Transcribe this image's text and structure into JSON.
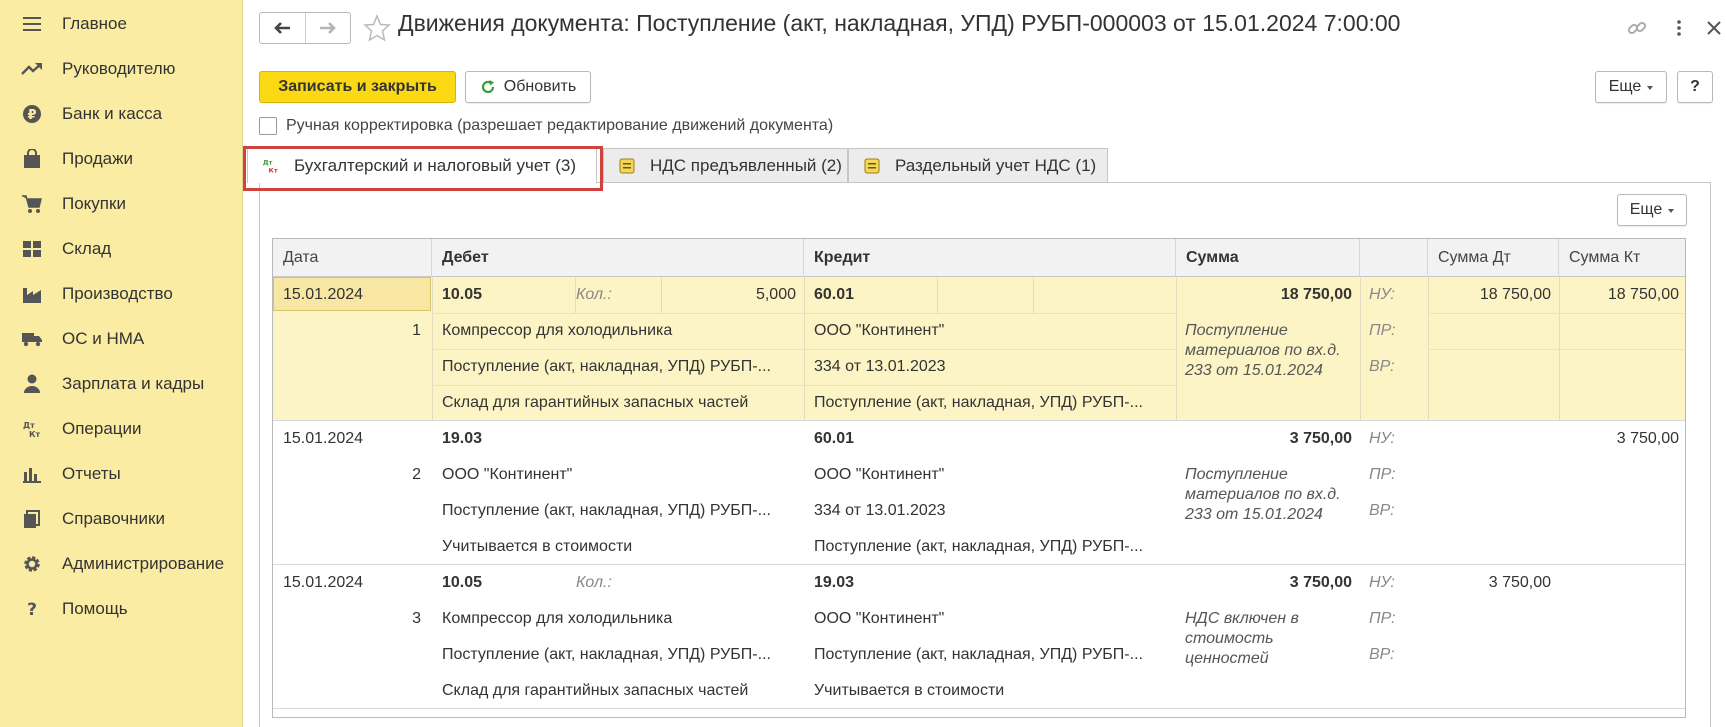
{
  "sidebar": {
    "items": [
      {
        "label": "Главное",
        "icon": "menu-icon"
      },
      {
        "label": "Руководителю",
        "icon": "trend-icon"
      },
      {
        "label": "Банк и касса",
        "icon": "ruble-coin-icon"
      },
      {
        "label": "Продажи",
        "icon": "shopping-bag-icon"
      },
      {
        "label": "Покупки",
        "icon": "cart-icon"
      },
      {
        "label": "Склад",
        "icon": "warehouse-grid-icon"
      },
      {
        "label": "Производство",
        "icon": "factory-icon"
      },
      {
        "label": "ОС и НМА",
        "icon": "truck-icon"
      },
      {
        "label": "Зарплата и кадры",
        "icon": "person-icon"
      },
      {
        "label": "Операции",
        "icon": "debit-credit-icon"
      },
      {
        "label": "Отчеты",
        "icon": "bar-chart-icon"
      },
      {
        "label": "Справочники",
        "icon": "books-icon"
      },
      {
        "label": "Администрирование",
        "icon": "gear-icon"
      },
      {
        "label": "Помощь",
        "icon": "question-icon"
      }
    ]
  },
  "header": {
    "title": "Движения документа: Поступление (акт, накладная, УПД) РУБП-000003 от 15.01.2024 7:00:00"
  },
  "toolbar": {
    "save_close_label": "Записать и закрыть",
    "refresh_label": "Обновить",
    "more_label": "Еще",
    "help_label": "?"
  },
  "manual_adjust": {
    "label": "Ручная корректировка (разрешает редактирование движений документа)",
    "checked": false
  },
  "tabs": [
    {
      "label": "Бухгалтерский и налоговый учет (3)",
      "icon": "debit-credit-icon",
      "active": true
    },
    {
      "label": "НДС предъявленный (2)",
      "icon": "register-icon",
      "active": false
    },
    {
      "label": "Раздельный учет НДС (1)",
      "icon": "register-icon",
      "active": false
    }
  ],
  "table_toolbar": {
    "more_label": "Еще"
  },
  "table": {
    "columns": {
      "date": "Дата",
      "debit": "Дебет",
      "credit": "Кредит",
      "sum": "Сумма",
      "sum_dt": "Сумма Дт",
      "sum_kt": "Сумма Кт"
    },
    "rows": [
      {
        "date": "15.01.2024",
        "num": "1",
        "debit_account": "10.05",
        "qty_label": "Кол.:",
        "qty": "5,000",
        "debit_sub": [
          "Компрессор для холодильника",
          "Поступление (акт, накладная, УПД) РУБП-...",
          "Склад для гарантийных запасных частей"
        ],
        "credit_account": "60.01",
        "credit_sub": [
          "ООО \"Континент\"",
          "334 от 13.01.2023",
          "Поступление (акт, накладная, УПД) РУБП-..."
        ],
        "sum": "18 750,00",
        "content": "Поступление материалов по вх.д. 233 от 15.01.2024",
        "nu_label": "НУ:",
        "pr_label": "ПР:",
        "vr_label": "ВР:",
        "sum_dt": "18 750,00",
        "sum_kt": "18 750,00"
      },
      {
        "date": "15.01.2024",
        "num": "2",
        "debit_account": "19.03",
        "debit_sub": [
          "ООО \"Континент\"",
          "Поступление (акт, накладная, УПД) РУБП-...",
          "Учитывается в стоимости"
        ],
        "credit_account": "60.01",
        "credit_sub": [
          "ООО \"Континент\"",
          "334 от 13.01.2023",
          "Поступление (акт, накладная, УПД) РУБП-..."
        ],
        "sum": "3 750,00",
        "content": "Поступление материалов по вх.д. 233 от 15.01.2024",
        "nu_label": "НУ:",
        "pr_label": "ПР:",
        "vr_label": "ВР:",
        "sum_dt": "",
        "sum_kt": "3 750,00"
      },
      {
        "date": "15.01.2024",
        "num": "3",
        "debit_account": "10.05",
        "qty_label": "Кол.:",
        "debit_sub": [
          "Компрессор для холодильника",
          "Поступление (акт, накладная, УПД) РУБП-...",
          "Склад для гарантийных запасных частей"
        ],
        "credit_account": "19.03",
        "credit_sub": [
          "ООО \"Континент\"",
          "Поступление (акт, накладная, УПД) РУБП-...",
          "Учитывается в стоимости"
        ],
        "sum": "3 750,00",
        "content": "НДС включен в стоимость ценностей",
        "nu_label": "НУ:",
        "pr_label": "ПР:",
        "vr_label": "ВР:",
        "sum_dt": "3 750,00",
        "sum_kt": ""
      }
    ]
  },
  "colors": {
    "sidebar_bg": "#fbeca3",
    "primary_button": "#fbd814",
    "selected_row": "#fdf4c5",
    "highlight_frame": "#d0423b"
  }
}
